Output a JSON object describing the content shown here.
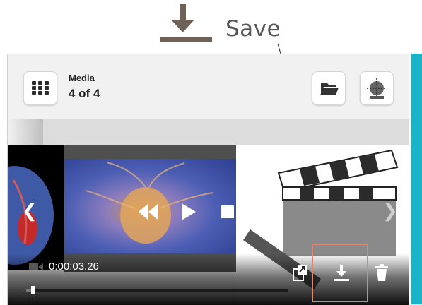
{
  "callout": {
    "label": "Save",
    "icon": "download-icon"
  },
  "header": {
    "title": "Media",
    "count": "4 of 4"
  },
  "player": {
    "timecode": "0:00:03.26",
    "progress": 0.02
  },
  "icons": {
    "grid": "grid-icon",
    "folder": "folder-icon",
    "focus": "focus-target-icon",
    "rewind": "rewind-icon",
    "play": "play-icon",
    "stop": "stop-icon",
    "forward": "fast-forward-icon",
    "prev": "chevron-left-icon",
    "next": "chevron-right-icon",
    "export": "export-icon",
    "save": "download-icon",
    "delete": "trash-icon"
  },
  "colors": {
    "accent": "#1ab3c8",
    "highlight": "#d9896f",
    "callout": "#6e6258"
  }
}
